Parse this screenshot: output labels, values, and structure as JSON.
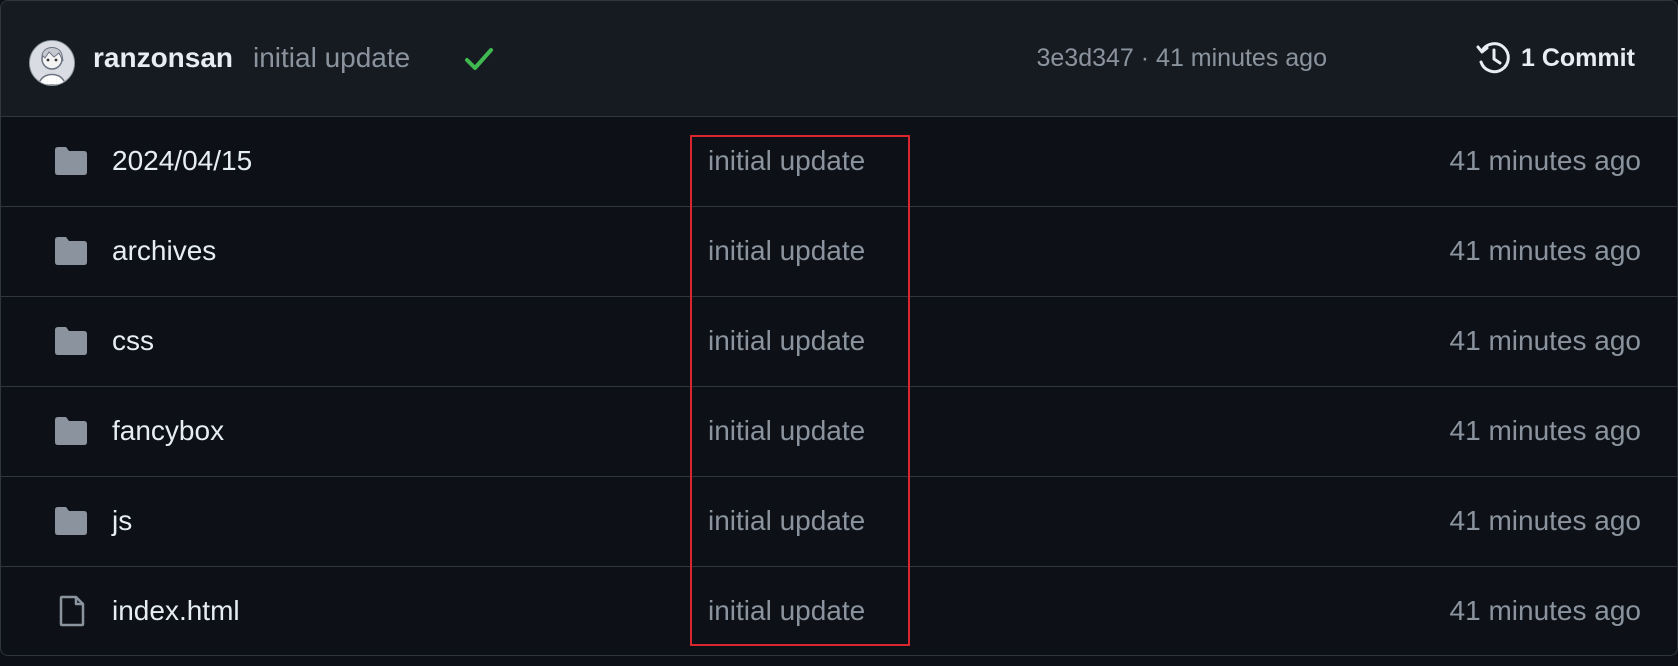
{
  "commit": {
    "author": "ranzonsan",
    "message": "initial update",
    "status_icon": "check-icon",
    "status_color": "#3fb950",
    "hash": "3e3d347",
    "separator": " · ",
    "time": "41 minutes ago",
    "history_label": "1 Commit",
    "history_icon": "history-clock-icon"
  },
  "files": [
    {
      "type": "folder",
      "icon": "folder-icon",
      "name": "2024/04/15",
      "message": "initial update",
      "date": "41 minutes ago"
    },
    {
      "type": "folder",
      "icon": "folder-icon",
      "name": "archives",
      "message": "initial update",
      "date": "41 minutes ago"
    },
    {
      "type": "folder",
      "icon": "folder-icon",
      "name": "css",
      "message": "initial update",
      "date": "41 minutes ago"
    },
    {
      "type": "folder",
      "icon": "folder-icon",
      "name": "fancybox",
      "message": "initial update",
      "date": "41 minutes ago"
    },
    {
      "type": "folder",
      "icon": "folder-icon",
      "name": "js",
      "message": "initial update",
      "date": "41 minutes ago"
    },
    {
      "type": "file",
      "icon": "file-icon",
      "name": "index.html",
      "message": "initial update",
      "date": "41 minutes ago"
    }
  ],
  "colors": {
    "background": "#0d1117",
    "header_background": "#161b22",
    "border": "#30363d",
    "muted_text": "#8b949e",
    "primary_text": "#e6edf3",
    "highlight_box": "#d7262f"
  }
}
